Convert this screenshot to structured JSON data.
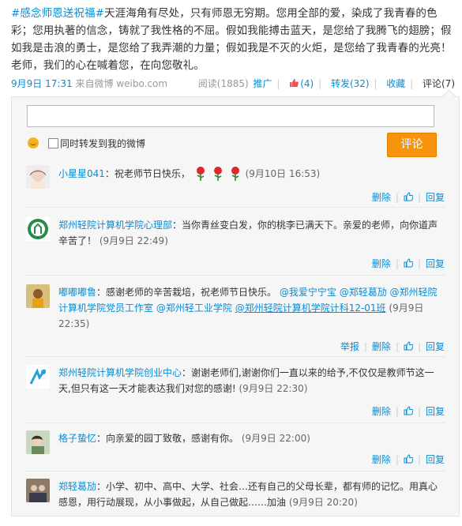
{
  "post": {
    "tag": "#感念师恩送祝福#",
    "text": "天涯海角有尽处，只有师恩无穷期。您用全部的爱，染成了我青春的色彩；您用执著的信念，铸就了我性格的不屈。假如我能搏击蓝天，是您给了我腾飞的翅膀；假如我是击浪的勇士，是您给了我弄潮的力量；假如我是不灭的火炬，是您给了我青春的光亮！老师，我们的心在喊着您，在向您敬礼。",
    "time": "9月9日 17:31",
    "source_prefix": "来自",
    "source": "微博 weibo.com",
    "reads": "阅读(1885)",
    "promote": "推广",
    "likes": "(4)",
    "forward": "转发(32)",
    "favorite": "收藏",
    "comment": "评论(7)"
  },
  "composer": {
    "input_value": "",
    "checkbox_label": "同时转发到我的微博",
    "submit_label": "评论"
  },
  "comments": [
    {
      "name": "小星星041",
      "text": "：祝老师节日快乐，",
      "time": "(9月10日 16:53)",
      "actions": [
        "删除",
        "",
        "回复"
      ]
    },
    {
      "name": "郑州轻院计算机学院心理部",
      "text": "：当你青丝变白发，你的桃李已满天下。亲爱的老师，向你道声辛苦了！",
      "time": "(9月9日 22:49)",
      "actions": [
        "删除",
        "",
        "回复"
      ]
    },
    {
      "name": "嘟嘟嘟鲁",
      "text": "：感谢老师的辛苦栽培，祝老师节日快乐。",
      "mentions": [
        "@我爱宁宁宝",
        "@郑轻葛劢",
        "@郑州轻院计算机学院党员工作室",
        "@郑州轻工业学院",
        "@郑州轻院计算机学院计科12-01班"
      ],
      "time": "(9月9日 22:35)",
      "actions": [
        "举报",
        "删除",
        "",
        "回复"
      ]
    },
    {
      "name": "郑州轻院计算机学院创业中心",
      "text": "：谢谢老师们,谢谢你们一直以来的给予,不仅仅是教师节这一天,但只有这一天才能表达我们对您的感谢!",
      "time": "(9月9日 22:30)",
      "actions": [
        "删除",
        "",
        "回复"
      ]
    },
    {
      "name": "格子蛰忆",
      "text": "：向亲爱的园丁致敬，感谢有你。",
      "time": "(9月9日 22:00)",
      "actions": [
        "删除",
        "",
        "回复"
      ]
    },
    {
      "name": "郑轻葛劢",
      "text": "：小学、初中、高中、大学、社会…还有自己的父母长辈，都有师的记忆。用真心感恩，用行动展现，从小事做起，从自己做起……加油",
      "time": "(9月9日 20:20)",
      "actions": []
    }
  ],
  "colors": {
    "link": "#0a8cd2",
    "button": "#f7940d",
    "panel": "#f6f6f6"
  }
}
